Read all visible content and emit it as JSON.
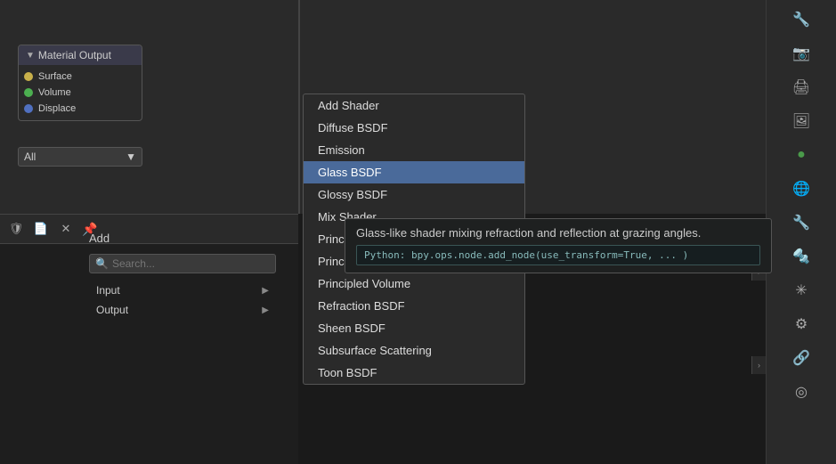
{
  "viewport": {
    "background": "#2a2a2a"
  },
  "node_editor": {
    "title": "Material Output",
    "dropdown_value": "All",
    "sockets": [
      {
        "label": "Surface",
        "color": "yellow"
      },
      {
        "label": "Volume",
        "color": "green"
      },
      {
        "label": "Displace",
        "color": "blue"
      }
    ]
  },
  "add_menu": {
    "label": "Add",
    "search_placeholder": "Search...",
    "items": [
      {
        "label": "Input",
        "has_arrow": true
      },
      {
        "label": "Output",
        "has_arrow": true
      }
    ]
  },
  "shader_menu": {
    "items": [
      {
        "label": "Add Shader",
        "highlighted": false
      },
      {
        "label": "Diffuse BSDF",
        "highlighted": false
      },
      {
        "label": "Emission",
        "highlighted": false
      },
      {
        "label": "Glass BSDF",
        "highlighted": true
      },
      {
        "label": "Glossy BSDF",
        "highlighted": false
      },
      {
        "label": "Mix Shader",
        "highlighted": false
      },
      {
        "label": "Principled BSDF",
        "highlighted": false
      },
      {
        "label": "Principled Hair BSDF",
        "highlighted": false
      },
      {
        "label": "Principled Volume",
        "highlighted": false
      },
      {
        "label": "Refraction BSDF",
        "highlighted": false
      },
      {
        "label": "Sheen BSDF",
        "highlighted": false
      },
      {
        "label": "Subsurface Scattering",
        "highlighted": false
      },
      {
        "label": "Toon BSDF",
        "highlighted": false
      }
    ]
  },
  "tooltip": {
    "description": "Glass-like shader mixing refraction and reflection at grazing angles.",
    "code": "Python: bpy.ops.node.add_node(use_transform=True, ... )"
  },
  "sidebar": {
    "icons": [
      {
        "name": "wrench-icon",
        "symbol": "🔧",
        "active": false
      },
      {
        "name": "render-icon",
        "symbol": "📷",
        "active": false
      },
      {
        "name": "output-icon",
        "symbol": "🖨",
        "active": false
      },
      {
        "name": "view-layer-icon",
        "symbol": "🖼",
        "active": false
      },
      {
        "name": "scene-icon",
        "symbol": "🔵",
        "active": false
      },
      {
        "name": "world-icon",
        "symbol": "🌐",
        "active": true
      },
      {
        "name": "object-icon",
        "symbol": "🔧",
        "active": false
      },
      {
        "name": "modifier-icon",
        "symbol": "🔩",
        "active": false
      },
      {
        "name": "particles-icon",
        "symbol": "✳",
        "active": false
      },
      {
        "name": "physics-icon",
        "symbol": "⚙",
        "active": false
      },
      {
        "name": "constraints-icon",
        "symbol": "🔗",
        "active": false
      },
      {
        "name": "data-icon",
        "symbol": "◎",
        "active": false
      }
    ]
  }
}
